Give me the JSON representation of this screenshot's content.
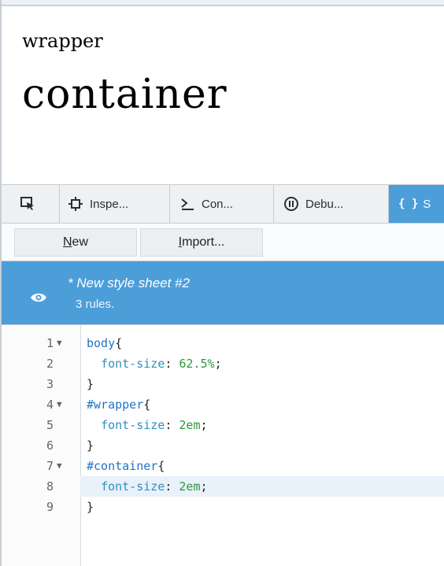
{
  "preview": {
    "wrapper_text": "wrapper",
    "container_text": "container"
  },
  "tabs": [
    {
      "label": "",
      "icon": "element-picker-icon"
    },
    {
      "label": "Inspe...",
      "icon": "inspector-icon"
    },
    {
      "label": "Con...",
      "icon": "console-icon"
    },
    {
      "label": "Debu...",
      "icon": "debugger-icon"
    },
    {
      "label": "S",
      "icon": "style-editor-icon",
      "active": true
    }
  ],
  "toolbar": {
    "new_label_first": "N",
    "new_label_rest": "ew",
    "import_label_first": "I",
    "import_label_rest": "mport..."
  },
  "stylesheet": {
    "name": "* New style sheet #2",
    "rules": "3 rules.",
    "visibility_icon": "eye-icon"
  },
  "editor": {
    "lines": [
      {
        "num": "1",
        "fold": true,
        "text": "body{"
      },
      {
        "num": "2",
        "fold": false,
        "text": "  font-size: 62.5%;"
      },
      {
        "num": "3",
        "fold": false,
        "text": "}"
      },
      {
        "num": "4",
        "fold": true,
        "text": "#wrapper{"
      },
      {
        "num": "5",
        "fold": false,
        "text": "  font-size: 2em;"
      },
      {
        "num": "6",
        "fold": false,
        "text": "}"
      },
      {
        "num": "7",
        "fold": true,
        "text": "#container{"
      },
      {
        "num": "8",
        "fold": false,
        "text": "  font-size: 2em;",
        "active": true
      },
      {
        "num": "9",
        "fold": false,
        "text": "}"
      }
    ],
    "tokens": {
      "l1_sel": "body",
      "l1_p": "{",
      "l2_prop": "font-size",
      "l2_colon": ": ",
      "l2_val": "62.5%",
      "l2_semi": ";",
      "l3": "}",
      "l4_sel": "#wrapper",
      "l4_p": "{",
      "l5_prop": "font-size",
      "l5_colon": ": ",
      "l5_val": "2em",
      "l5_semi": ";",
      "l6": "}",
      "l7_sel": "#container",
      "l7_p": "{",
      "l8_prop": "font-size",
      "l8_colon": ": ",
      "l8_val": "2em",
      "l8_semi": ";",
      "l9": "}"
    }
  },
  "colors": {
    "accent": "#4c9ed9",
    "selector": "#2374c6",
    "property": "#2e8fbf",
    "value": "#2a9a3a"
  }
}
